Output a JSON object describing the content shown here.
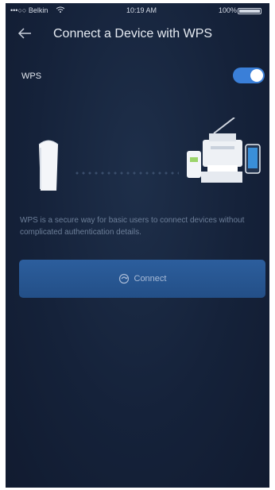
{
  "status_bar": {
    "carrier": "•••○○ Belkin",
    "time": "10:19 AM",
    "battery": "100%"
  },
  "header": {
    "title": "Connect a Device with WPS"
  },
  "wps": {
    "label": "WPS",
    "enabled": true
  },
  "description": "WPS is a secure way for basic users to connect devices without complicated authentication details.",
  "connect_button": {
    "label": "Connect"
  },
  "colors": {
    "background": "#15223a",
    "accent": "#3a7fd8",
    "button": "#2c5e9d"
  },
  "icons": [
    "back-arrow-icon",
    "wifi-icon",
    "wps-icon",
    "node-icon",
    "devices-icon"
  ]
}
